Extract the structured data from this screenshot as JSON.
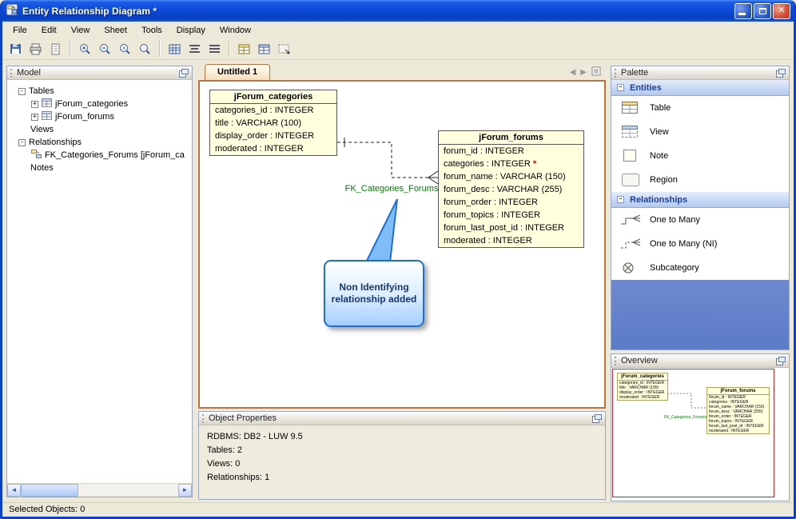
{
  "window": {
    "title": "Entity Relationship Diagram *",
    "status": "Selected Objects: 0"
  },
  "menu": {
    "items": [
      "File",
      "Edit",
      "View",
      "Sheet",
      "Tools",
      "Display",
      "Window"
    ]
  },
  "toolbar": {
    "buttons": [
      "save",
      "print",
      "page",
      "zoom-in",
      "zoom-out",
      "zoom-original",
      "zoom-tool",
      "grid",
      "distribute-rows",
      "distribute-columns",
      "insert-table",
      "insert-view",
      "insert-region"
    ]
  },
  "model_panel": {
    "title": "Model",
    "items": {
      "tables": "Tables",
      "table1": "jForum_categories",
      "table2": "jForum_forums",
      "views": "Views",
      "relationships": "Relationships",
      "rel1": "FK_Categories_Forums [jForum_ca",
      "notes": "Notes"
    }
  },
  "canvas": {
    "tab": "Untitled 1",
    "relationship": {
      "label": "FK_Categories_Forums"
    },
    "callout": {
      "text": "Non Identifying relationship added"
    },
    "tables": [
      {
        "name": "jForum_categories",
        "fields": [
          {
            "text": "categories_id : INTEGER"
          },
          {
            "text": "title : VARCHAR (100)"
          },
          {
            "text": "display_order : INTEGER"
          },
          {
            "text": "moderated : INTEGER"
          }
        ]
      },
      {
        "name": "jForum_forums",
        "fields": [
          {
            "text": "forum_id : INTEGER"
          },
          {
            "text": "categories : INTEGER",
            "suffix": "*"
          },
          {
            "text": "forum_name : VARCHAR (150)"
          },
          {
            "text": "forum_desc : VARCHAR (255)"
          },
          {
            "text": "forum_order : INTEGER"
          },
          {
            "text": "forum_topics : INTEGER"
          },
          {
            "text": "forum_last_post_id : INTEGER"
          },
          {
            "text": "moderated : INTEGER"
          }
        ]
      }
    ]
  },
  "object_properties": {
    "title": "Object Properties",
    "rdbms": "RDBMS: DB2 - LUW 9.5",
    "tables": "Tables: 2",
    "views": "Views: 0",
    "relationships": "Relationships: 1"
  },
  "palette": {
    "title": "Palette",
    "entities": {
      "label": "Entities",
      "items": [
        "Table",
        "View",
        "Note",
        "Region"
      ]
    },
    "relationships": {
      "label": "Relationships",
      "items": [
        "One to Many",
        "One to Many (NI)",
        "Subcategory"
      ]
    }
  },
  "overview": {
    "title": "Overview"
  },
  "colors": {
    "titlebar_blue": "#0D4AD8",
    "canvas_border_orange": "#C0703C",
    "table_fill": "#FFFFDE",
    "relationship_label_green": "#007F00",
    "callout_border_blue": "#1E6FD0",
    "required_red": "#D00000",
    "overview_viewport_red": "#CC2222"
  }
}
